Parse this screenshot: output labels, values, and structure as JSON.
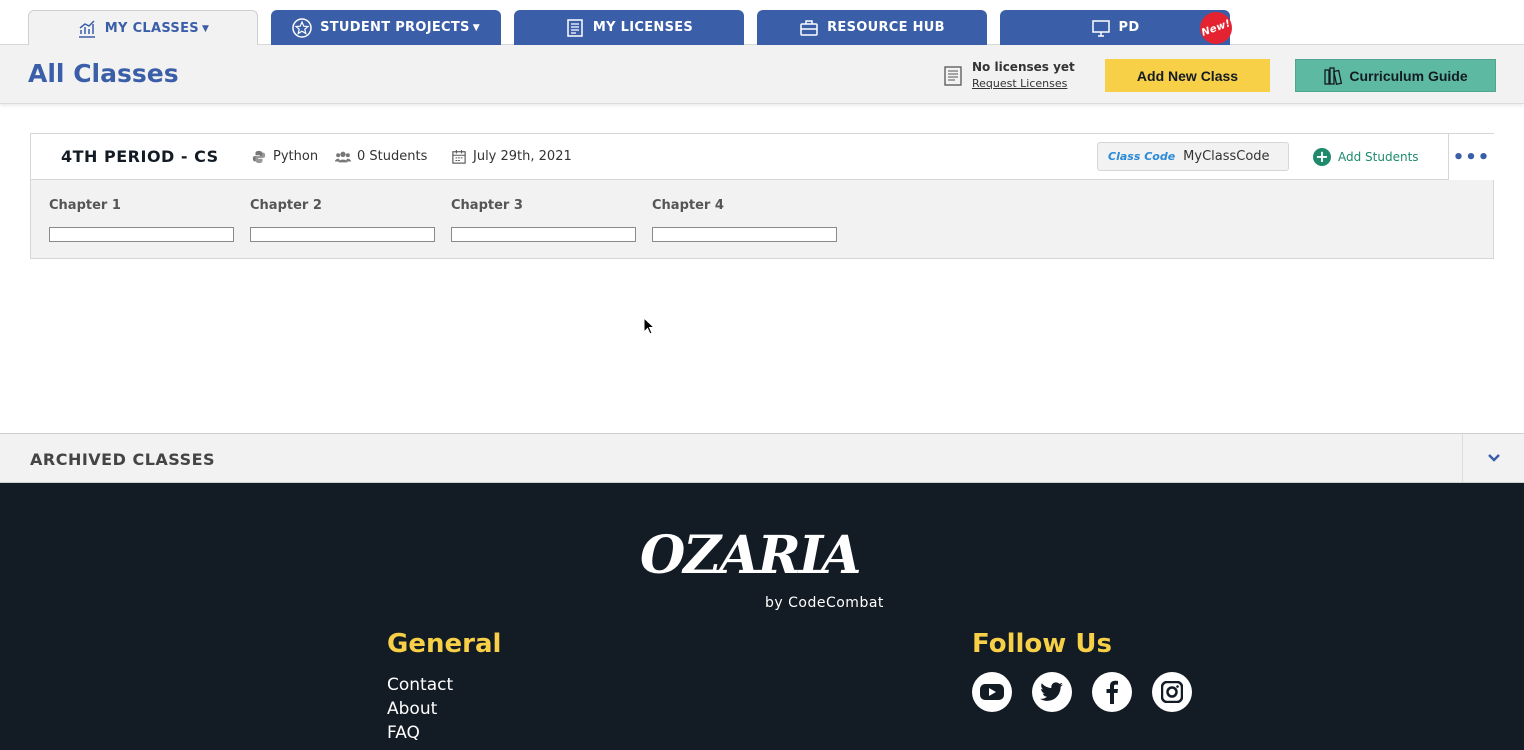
{
  "tabs": [
    {
      "label": "MY CLASSES",
      "icon": "chart-icon",
      "active": true,
      "caret": true
    },
    {
      "label": "STUDENT PROJECTS",
      "icon": "star-icon",
      "active": false,
      "caret": true
    },
    {
      "label": "MY LICENSES",
      "icon": "license-icon",
      "active": false,
      "caret": false
    },
    {
      "label": "RESOURCE HUB",
      "icon": "briefcase-icon",
      "active": false,
      "caret": false
    },
    {
      "label": "PD",
      "icon": "monitor-icon",
      "active": false,
      "caret": false,
      "badge": "New!"
    }
  ],
  "header": {
    "title": "All Classes",
    "license_status": "No licenses yet",
    "license_link": "Request Licenses",
    "add_class_label": "Add New Class",
    "curriculum_label": "Curriculum Guide"
  },
  "class": {
    "name": "4TH PERIOD - CS",
    "language": "Python",
    "students": "0 Students",
    "date": "July 29th, 2021",
    "code_label": "Class Code",
    "code_value": "MyClassCode",
    "add_students_label": "Add Students",
    "more_label": "•••",
    "chapters": [
      {
        "label": "Chapter 1",
        "progress": 0
      },
      {
        "label": "Chapter 2",
        "progress": 0
      },
      {
        "label": "Chapter 3",
        "progress": 0
      },
      {
        "label": "Chapter 4",
        "progress": 0
      }
    ]
  },
  "archived": {
    "title": "ARCHIVED CLASSES"
  },
  "footer": {
    "logo": "OZARIA",
    "logo_sub": "by CodeCombat",
    "general_title": "General",
    "general_links": [
      "Contact",
      "About",
      "FAQ"
    ],
    "follow_title": "Follow Us",
    "social": [
      "youtube-icon",
      "twitter-icon",
      "facebook-icon",
      "instagram-icon"
    ]
  },
  "colors": {
    "primary_blue": "#3b5ea8",
    "yellow": "#f7d047",
    "teal": "#5db9a2",
    "footer_bg": "#131b25",
    "badge_red": "#e52330"
  }
}
